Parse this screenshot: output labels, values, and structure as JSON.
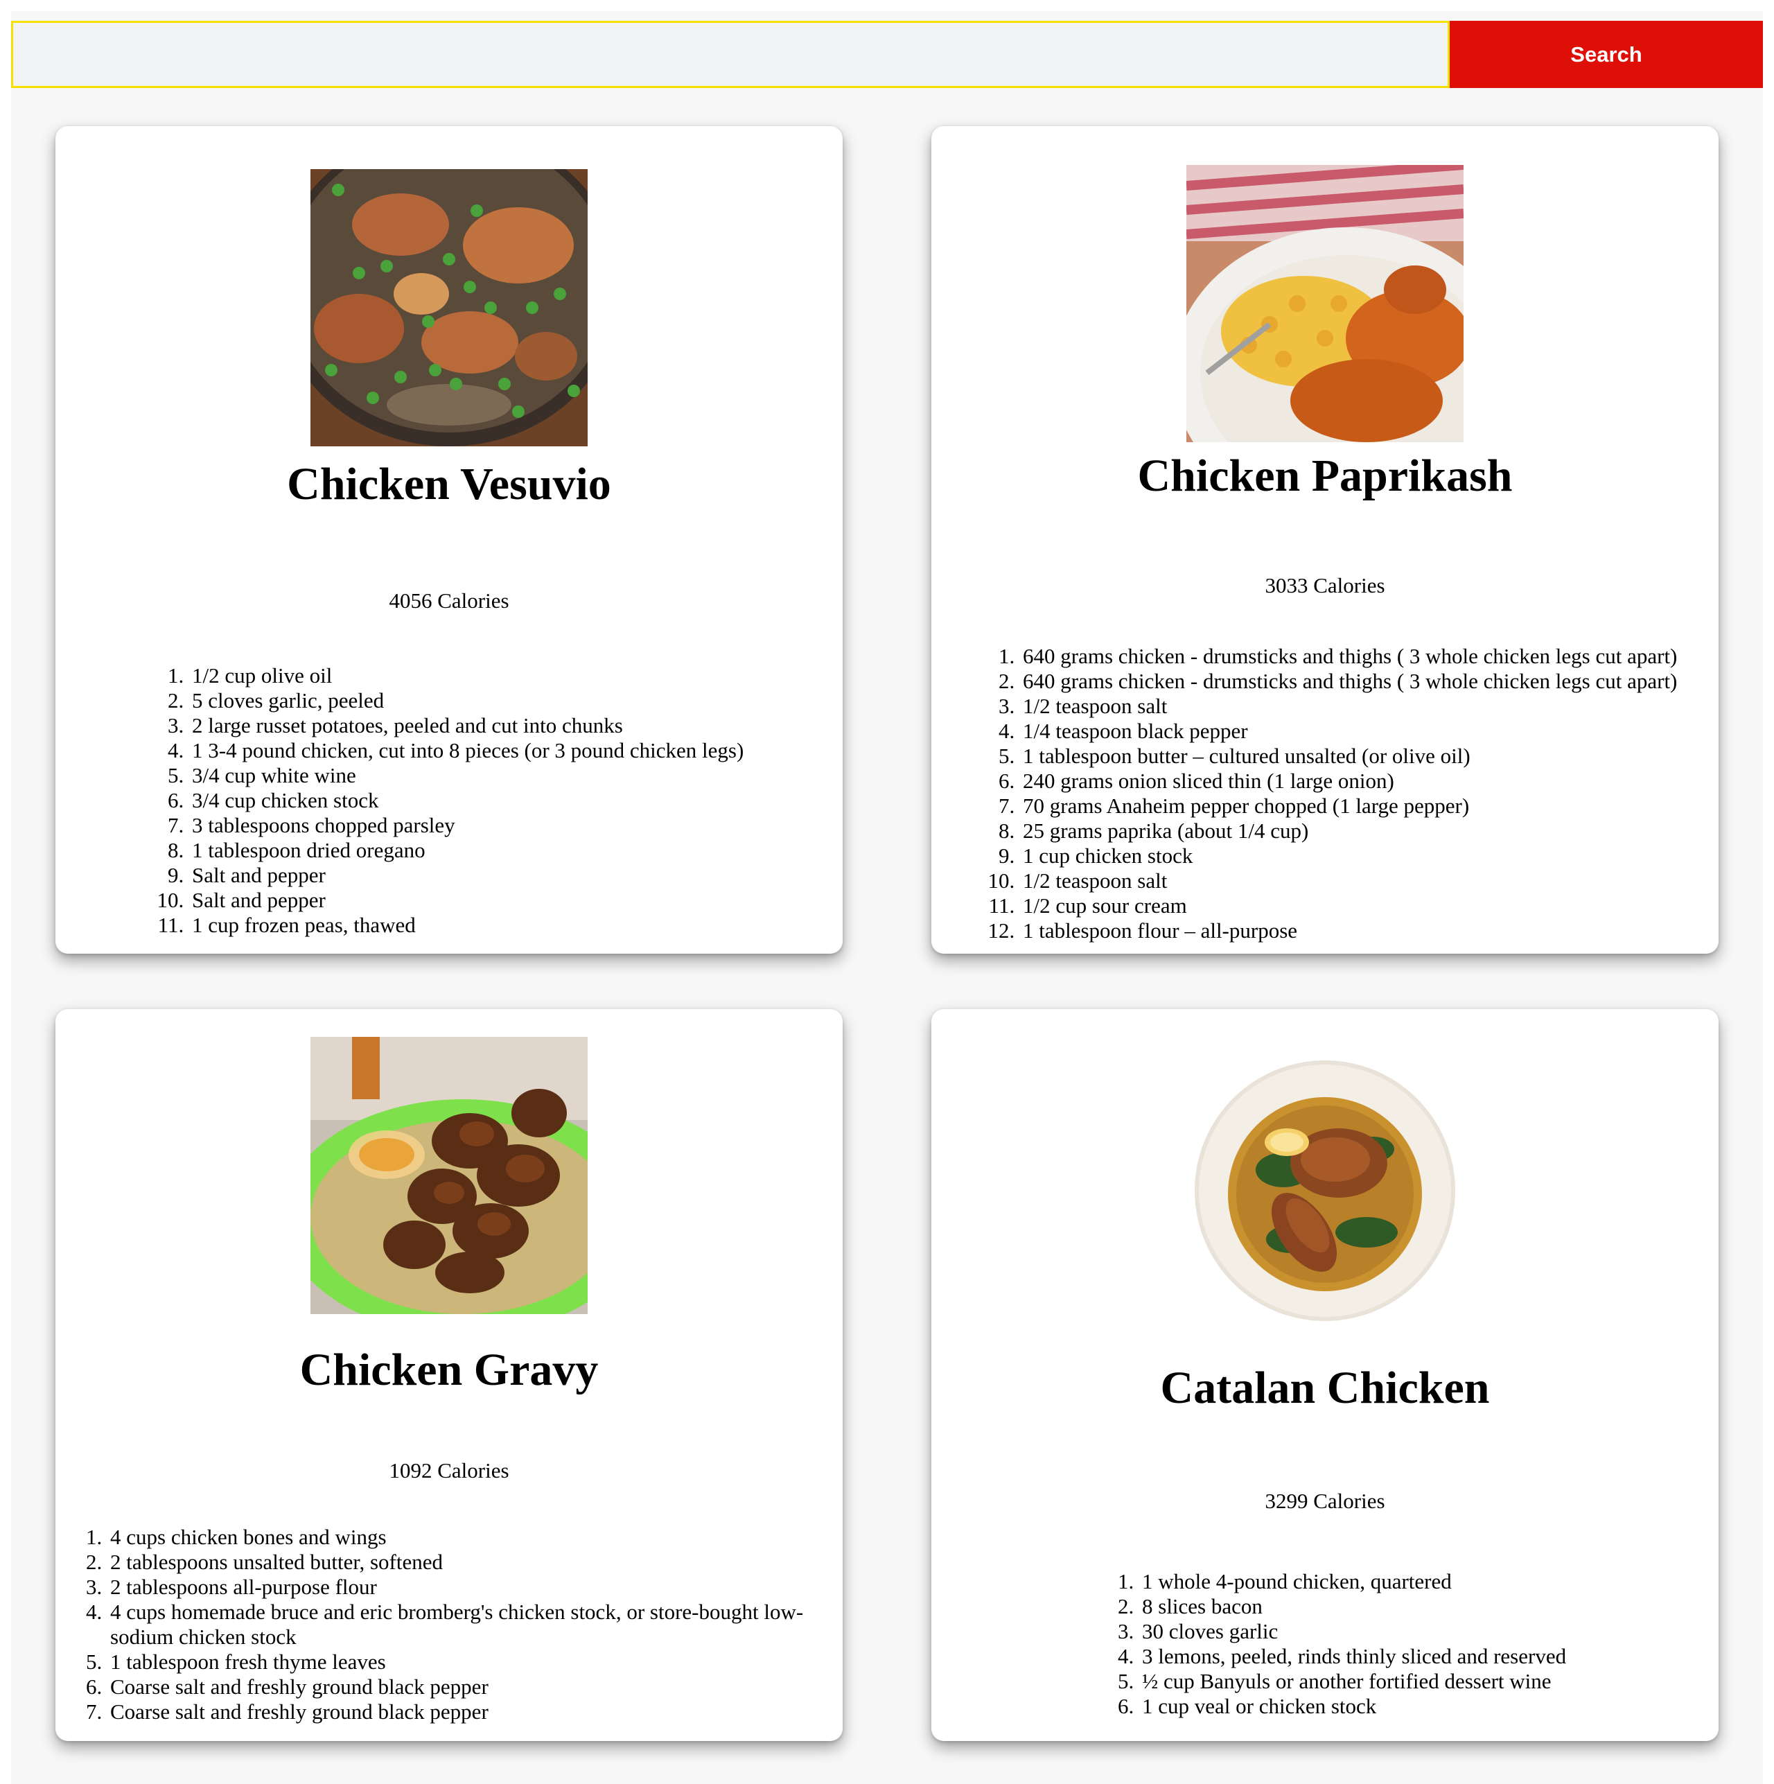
{
  "search": {
    "value": "",
    "placeholder": "",
    "button_label": "Search"
  },
  "colors": {
    "search_button_bg": "#de0f07",
    "search_input_border": "#f5e000"
  },
  "recipes": [
    {
      "title": "Chicken Vesuvio",
      "calories": "4056 Calories",
      "image": "chicken-vesuvio-photo",
      "ingredients": [
        "1/2 cup olive oil",
        "5 cloves garlic, peeled",
        "2 large russet potatoes, peeled and cut into chunks",
        "1 3-4 pound chicken, cut into 8 pieces (or 3 pound chicken legs)",
        "3/4 cup white wine",
        "3/4 cup chicken stock",
        "3 tablespoons chopped parsley",
        "1 tablespoon dried oregano",
        "Salt and pepper",
        "Salt and pepper",
        "1 cup frozen peas, thawed"
      ]
    },
    {
      "title": "Chicken Paprikash",
      "calories": "3033 Calories",
      "image": "chicken-paprikash-photo",
      "ingredients": [
        "640 grams chicken - drumsticks and thighs ( 3 whole chicken legs cut apart)",
        "640 grams chicken - drumsticks and thighs ( 3 whole chicken legs cut apart)",
        "1/2 teaspoon salt",
        "1/4 teaspoon black pepper",
        "1 tablespoon butter – cultured unsalted (or olive oil)",
        "240 grams onion sliced thin (1 large onion)",
        "70 grams Anaheim pepper chopped (1 large pepper)",
        "25 grams paprika (about 1/4 cup)",
        "1 cup chicken stock",
        "1/2 teaspoon salt",
        "1/2 cup sour cream",
        "1 tablespoon flour – all-purpose"
      ]
    },
    {
      "title": "Chicken Gravy",
      "calories": "1092 Calories",
      "image": "chicken-gravy-photo",
      "ingredients": [
        "4 cups chicken bones and wings",
        "2 tablespoons unsalted butter, softened",
        "2 tablespoons all-purpose flour",
        "4 cups homemade bruce and eric bromberg's chicken stock, or store-bought low-sodium chicken stock",
        "1 tablespoon fresh thyme leaves",
        "Coarse salt and freshly ground black pepper",
        "Coarse salt and freshly ground black pepper"
      ]
    },
    {
      "title": "Catalan Chicken",
      "calories": "3299 Calories",
      "image": "catalan-chicken-photo",
      "ingredients": [
        "1 whole 4-pound chicken, quartered",
        "8 slices bacon",
        "30 cloves garlic",
        "3 lemons, peeled, rinds thinly sliced and reserved",
        "½ cup Banyuls or another fortified dessert wine",
        "1 cup veal or chicken stock"
      ]
    }
  ]
}
